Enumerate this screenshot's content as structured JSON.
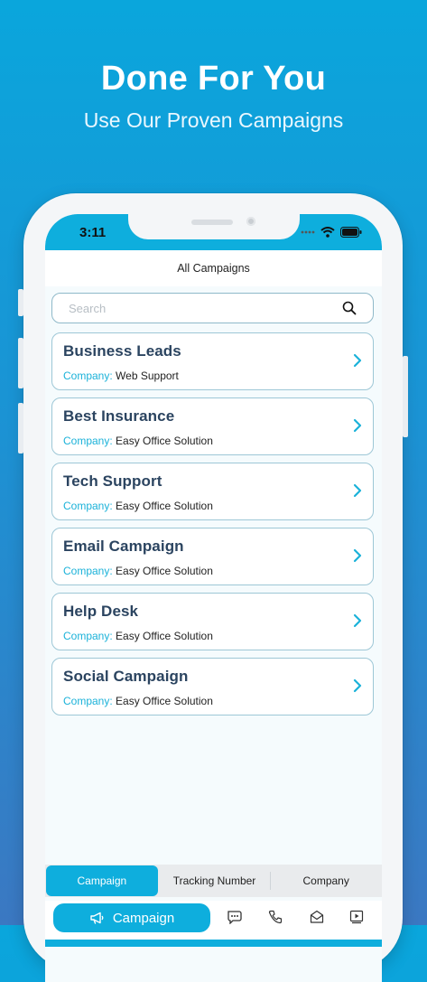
{
  "hero": {
    "title": "Done For You",
    "subtitle": "Use Our Proven Campaigns"
  },
  "statusbar": {
    "time": "3:11"
  },
  "navbar": {
    "title": "All Campaigns"
  },
  "search": {
    "placeholder": "Search",
    "value": ""
  },
  "campaigns": [
    {
      "title": "Business Leads",
      "company_label": "Company:",
      "company": "Web Support"
    },
    {
      "title": "Best Insurance",
      "company_label": "Company:",
      "company": "Easy Office Solution"
    },
    {
      "title": "Tech Support",
      "company_label": "Company:",
      "company": "Easy Office Solution"
    },
    {
      "title": "Email Campaign",
      "company_label": "Company:",
      "company": "Easy Office Solution"
    },
    {
      "title": "Help Desk",
      "company_label": "Company:",
      "company": "Easy Office Solution"
    },
    {
      "title": "Social Campaign",
      "company_label": "Company:",
      "company": "Easy Office Solution"
    }
  ],
  "tabs": [
    {
      "label": "Campaign",
      "active": true
    },
    {
      "label": "Tracking Number",
      "active": false
    },
    {
      "label": "Company",
      "active": false
    }
  ],
  "bottom_nav": {
    "primary_label": "Campaign",
    "icons": [
      "megaphone-icon",
      "chat-icon",
      "phone-icon",
      "mail-icon",
      "video-icon"
    ]
  },
  "colors": {
    "accent": "#0eaedd",
    "title_text": "#2b4460",
    "label_text": "#1bb2d9"
  }
}
